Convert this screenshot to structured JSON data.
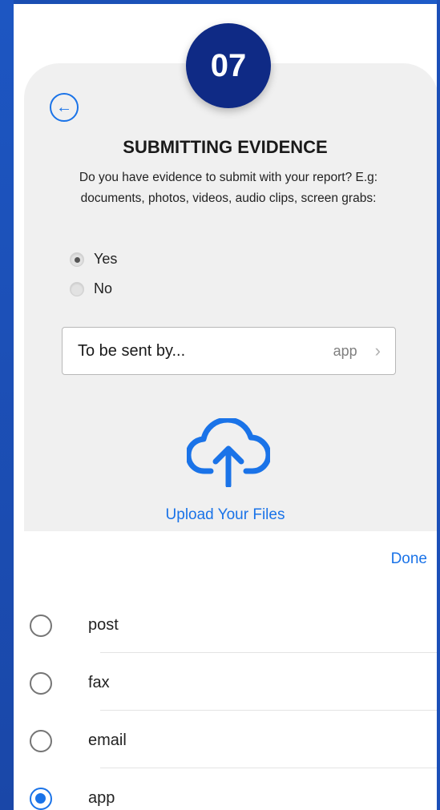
{
  "step": {
    "number": "07"
  },
  "header": {
    "title": "SUBMITTING EVIDENCE"
  },
  "question": {
    "text": "Do you have evidence to submit with your report? E.g: documents, photos, videos, audio clips, screen grabs:"
  },
  "evidence_choice": {
    "options": [
      {
        "label": "Yes",
        "checked": true
      },
      {
        "label": "No",
        "checked": false
      }
    ]
  },
  "send_method": {
    "label": "To be sent by...",
    "value": "app"
  },
  "upload": {
    "label": "Upload Your Files"
  },
  "picker": {
    "done_label": "Done",
    "options": [
      {
        "label": "post",
        "selected": false
      },
      {
        "label": "fax",
        "selected": false
      },
      {
        "label": "email",
        "selected": false
      },
      {
        "label": "app",
        "selected": true
      }
    ]
  },
  "colors": {
    "accent": "#1a73e8",
    "badge": "#0f2a85",
    "background": "#1e5fcf"
  },
  "icons": [
    "back-arrow-icon",
    "chevron-right-icon",
    "cloud-upload-icon"
  ]
}
